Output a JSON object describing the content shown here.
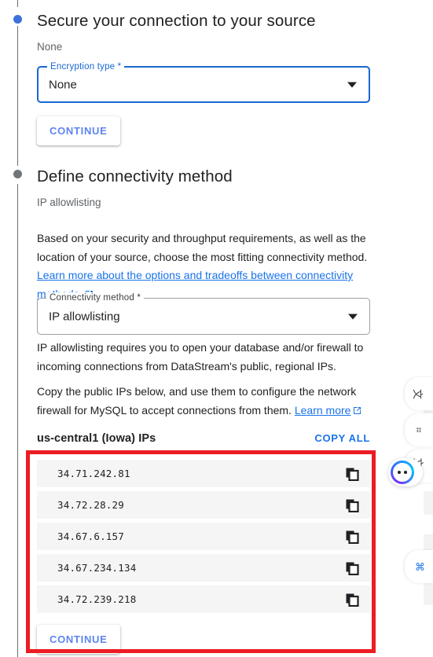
{
  "steps": [
    {
      "id": "secure-connection",
      "title": "Secure your connection to your source",
      "subtitle": "None",
      "field": {
        "label": "Encryption type *",
        "value": "None"
      },
      "continue_label": "CONTINUE"
    },
    {
      "id": "connectivity-method",
      "title": "Define connectivity method",
      "subtitle": "IP allowlisting",
      "paragraph1": "Based on your security and throughput requirements, as well as the location of your source, choose the most fitting connectivity method.",
      "link1": "Learn more about the options and tradeoffs between connectivity methods.",
      "field": {
        "label": "Connectivity method *",
        "value": "IP allowlisting"
      },
      "paragraph2": "IP allowlisting requires you to open your database and/or firewall to incoming connections from DataStream's public, regional IPs.",
      "paragraph3": "Copy the public IPs below, and use them to configure the network firewall for MySQL to accept connections from them.",
      "link2": "Learn more",
      "continue_label": "CONTINUE"
    }
  ],
  "ips_section": {
    "title": "us-central1 (Iowa) IPs",
    "copy_all_label": "COPY ALL",
    "ips": [
      "34.71.242.81",
      "34.72.28.29",
      "34.67.6.157",
      "34.67.234.134",
      "34.72.239.218"
    ],
    "copy_icon_name": "copy-icon"
  },
  "right_rail": {
    "items": [
      {
        "name": "chat-tool-icon",
        "glyph": "文"
      },
      {
        "name": "apps-tool-icon",
        "glyph": "⌗"
      },
      {
        "name": "translate-tool-icon",
        "glyph": "文A"
      },
      {
        "name": "network-tool-icon",
        "glyph": "⌘"
      }
    ],
    "assistant_name": "assistant-avatar"
  },
  "colors": {
    "accent_blue": "#1a73e8",
    "active_bullet": "#3b71d9",
    "inactive_bullet": "#70757a",
    "highlight_red": "#ed1c24",
    "ip_row_bg": "#f5f5f5"
  }
}
